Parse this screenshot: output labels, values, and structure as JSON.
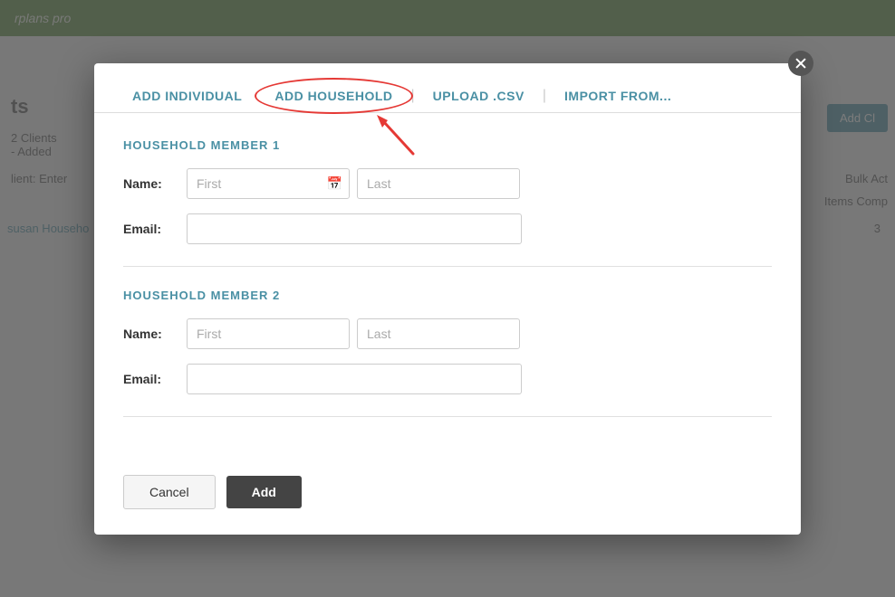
{
  "topBar": {
    "brand": "rplans pro"
  },
  "background": {
    "pageTitle": "ts",
    "clientsLine1": "2 Clients",
    "clientsLine2": "- Added",
    "addClientBtn": "Add Cl",
    "searchLabel": "lient:  Enter",
    "bulkAction": "Bulk Act",
    "itemsComplete": "Items Comp",
    "susanHousehold": "susan Househo",
    "susanNum": "3"
  },
  "modal": {
    "closeLabel": "×",
    "tabs": [
      {
        "id": "add-individual",
        "label": "ADD INDIVIDUAL",
        "active": false
      },
      {
        "id": "add-household",
        "label": "ADD HOUSEHOLD",
        "active": true
      },
      {
        "id": "upload-csv",
        "label": "UPLOAD .CSV",
        "active": false
      },
      {
        "id": "import-from",
        "label": "IMPORT FROM...",
        "active": false
      }
    ],
    "member1": {
      "sectionTitle": "HOUSEHOLD MEMBER 1",
      "nameLabel": "Name:",
      "firstPlaceholder": "First",
      "lastPlaceholder": "Last",
      "emailLabel": "Email:",
      "emailPlaceholder": ""
    },
    "member2": {
      "sectionTitle": "HOUSEHOLD MEMBER 2",
      "nameLabel": "Name:",
      "firstPlaceholder": "First",
      "lastPlaceholder": "Last",
      "emailLabel": "Email:",
      "emailPlaceholder": ""
    },
    "footer": {
      "cancelLabel": "Cancel",
      "addLabel": "Add"
    }
  },
  "colors": {
    "accent": "#4a90a4",
    "redAnnotation": "#e53935",
    "activeTab": "#333333",
    "btnDark": "#444444"
  }
}
